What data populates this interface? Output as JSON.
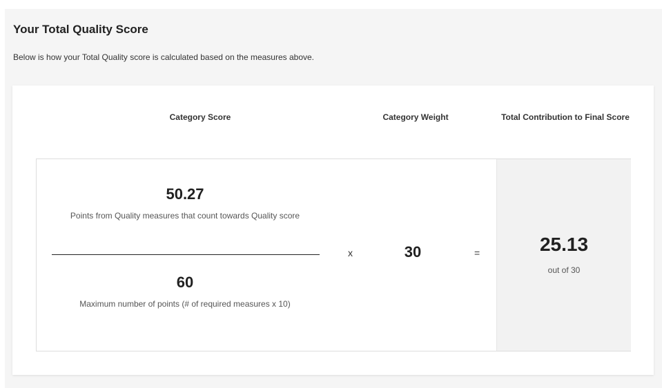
{
  "section": {
    "title": "Your Total Quality Score",
    "description": "Below is how your Total Quality score is calculated based on the measures above."
  },
  "columns": {
    "category_score": "Category Score",
    "category_weight": "Category Weight",
    "total_contribution": "Total Contribution to Final Score"
  },
  "calculation": {
    "numerator_value": "50.27",
    "numerator_label": "Points from Quality measures that count towards Quality score",
    "denominator_value": "60",
    "denominator_label": "Maximum number of points (# of required measures x 10)",
    "multiply_symbol": "x",
    "weight_value": "30",
    "equals_symbol": "=",
    "total_value": "25.13",
    "total_label": "out of 30"
  }
}
